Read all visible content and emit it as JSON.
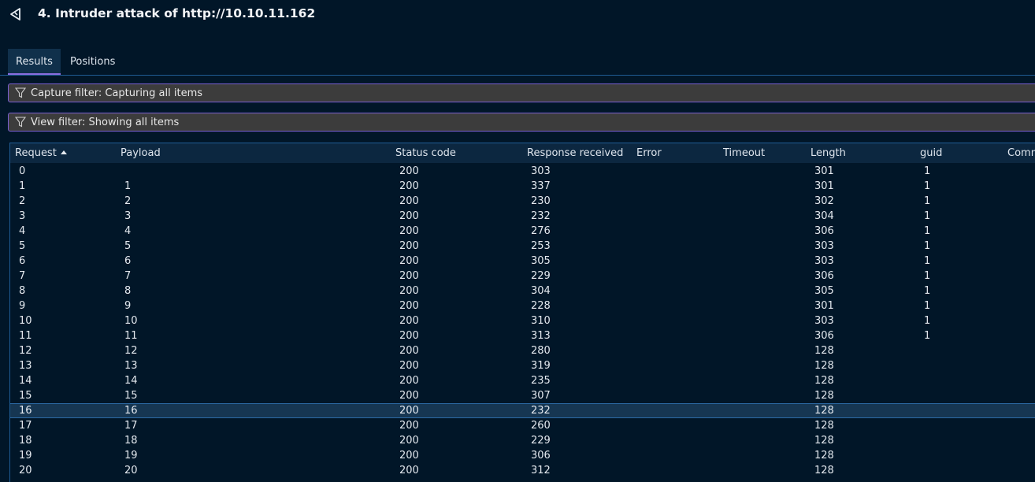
{
  "header": {
    "title": "4. Intruder attack of http://10.10.11.162",
    "icon": "burp-back-icon"
  },
  "tabs": [
    {
      "label": "Results",
      "active": true
    },
    {
      "label": "Positions",
      "active": false
    }
  ],
  "filters": {
    "capture": "Capture filter: Capturing all items",
    "view": "View filter: Showing all items"
  },
  "table": {
    "columns": [
      "Request",
      "Payload",
      "Status code",
      "Response received",
      "Error",
      "Timeout",
      "Length",
      "guid",
      "Comm"
    ],
    "sort": {
      "column": "Request",
      "direction": "ascending"
    },
    "selected_row": 16,
    "rows": [
      [
        "0",
        "",
        "200",
        "303",
        "",
        "",
        "301",
        "1",
        ""
      ],
      [
        "1",
        "1",
        "200",
        "337",
        "",
        "",
        "301",
        "1",
        ""
      ],
      [
        "2",
        "2",
        "200",
        "230",
        "",
        "",
        "302",
        "1",
        ""
      ],
      [
        "3",
        "3",
        "200",
        "232",
        "",
        "",
        "304",
        "1",
        ""
      ],
      [
        "4",
        "4",
        "200",
        "276",
        "",
        "",
        "306",
        "1",
        ""
      ],
      [
        "5",
        "5",
        "200",
        "253",
        "",
        "",
        "303",
        "1",
        ""
      ],
      [
        "6",
        "6",
        "200",
        "305",
        "",
        "",
        "303",
        "1",
        ""
      ],
      [
        "7",
        "7",
        "200",
        "229",
        "",
        "",
        "306",
        "1",
        ""
      ],
      [
        "8",
        "8",
        "200",
        "304",
        "",
        "",
        "305",
        "1",
        ""
      ],
      [
        "9",
        "9",
        "200",
        "228",
        "",
        "",
        "301",
        "1",
        ""
      ],
      [
        "10",
        "10",
        "200",
        "310",
        "",
        "",
        "303",
        "1",
        ""
      ],
      [
        "11",
        "11",
        "200",
        "313",
        "",
        "",
        "306",
        "1",
        ""
      ],
      [
        "12",
        "12",
        "200",
        "280",
        "",
        "",
        "128",
        "",
        ""
      ],
      [
        "13",
        "13",
        "200",
        "319",
        "",
        "",
        "128",
        "",
        ""
      ],
      [
        "14",
        "14",
        "200",
        "235",
        "",
        "",
        "128",
        "",
        ""
      ],
      [
        "15",
        "15",
        "200",
        "307",
        "",
        "",
        "128",
        "",
        ""
      ],
      [
        "16",
        "16",
        "200",
        "232",
        "",
        "",
        "128",
        "",
        ""
      ],
      [
        "17",
        "17",
        "200",
        "260",
        "",
        "",
        "128",
        "",
        ""
      ],
      [
        "18",
        "18",
        "200",
        "229",
        "",
        "",
        "128",
        "",
        ""
      ],
      [
        "19",
        "19",
        "200",
        "306",
        "",
        "",
        "128",
        "",
        ""
      ],
      [
        "20",
        "20",
        "200",
        "312",
        "",
        "",
        "128",
        "",
        ""
      ]
    ]
  }
}
